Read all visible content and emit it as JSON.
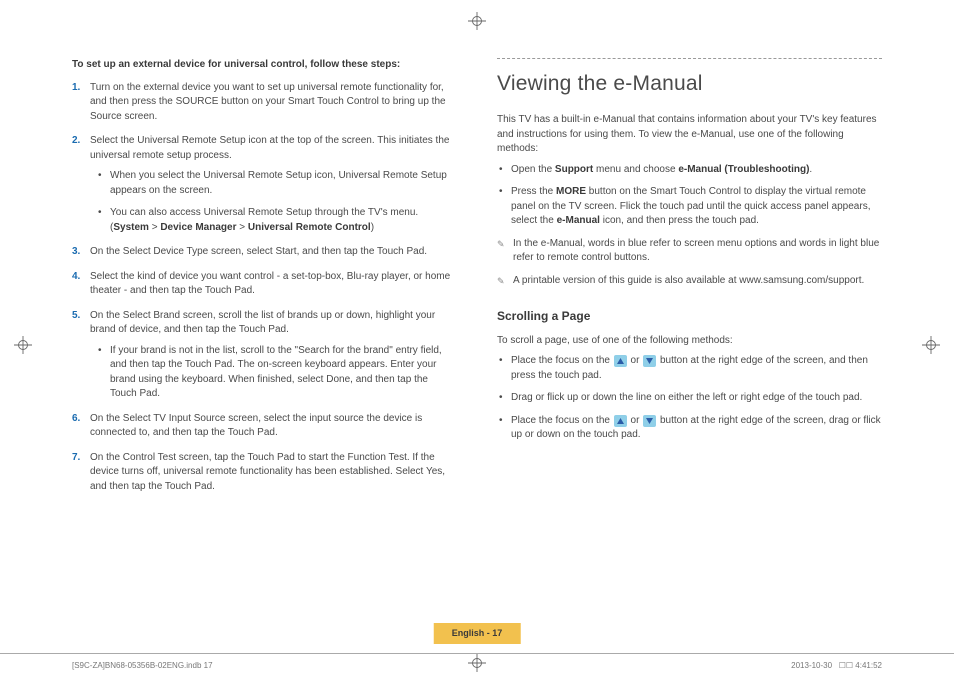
{
  "left": {
    "heading": "To set up an external device for universal control, follow these steps:",
    "steps": [
      {
        "num": "1.",
        "text": "Turn on the external device you want to set up universal remote functionality for, and then press the SOURCE button on your Smart Touch Control to bring up the Source screen."
      },
      {
        "num": "2.",
        "text": "Select the Universal Remote Setup icon at the top of the screen. This initiates the universal remote setup process.",
        "sub": [
          "When you select the Universal Remote Setup icon, Universal Remote Setup appears on the screen.",
          "You can also access Universal Remote Setup through the TV's menu. (",
          ")"
        ],
        "menu_path": [
          "System",
          " > ",
          "Device Manager",
          " > ",
          "Universal Remote Control"
        ]
      },
      {
        "num": "3.",
        "text": "On the Select Device Type screen, select Start, and then tap the Touch Pad."
      },
      {
        "num": "4.",
        "text": "Select the kind of device you want control - a set-top-box, Blu-ray player, or home theater - and then tap the Touch Pad."
      },
      {
        "num": "5.",
        "text": "On the Select Brand screen, scroll the list of brands up or down, highlight your brand of device, and then tap the Touch Pad.",
        "sub5": "If your brand is not in the list, scroll to the \"Search for the brand\" entry field, and then tap the Touch Pad. The on-screen keyboard appears. Enter your brand using the keyboard. When finished, select Done, and then tap the Touch Pad."
      },
      {
        "num": "6.",
        "text": "On the Select TV Input Source screen, select the input source the device is connected to, and then tap the Touch Pad."
      },
      {
        "num": "7.",
        "text": "On the Control Test screen, tap the Touch Pad to start the Function Test. If the device turns off, universal remote functionality has been established. Select Yes, and then tap the Touch Pad."
      }
    ]
  },
  "right": {
    "title": "Viewing the e-Manual",
    "intro": "This TV has a built-in e-Manual that contains information about your TV's key features and instructions for using them. To view the e-Manual, use one of the following methods:",
    "bullets": [
      {
        "pre": "Open the ",
        "b1": "Support",
        "mid": " menu and choose ",
        "b2": "e-Manual (Troubleshooting)",
        "post": "."
      },
      {
        "pre": "Press the ",
        "b1": "MORE",
        "mid": " button on the Smart Touch Control to display the virtual remote panel on the TV screen. Flick the touch pad until the quick access panel appears, select the ",
        "b2": "e-Manual",
        "post": " icon, and then press the touch pad."
      }
    ],
    "notes": [
      "In the e-Manual, words in blue refer to screen menu options and words in light blue refer to remote control buttons.",
      "A printable version of this guide is also available at www.samsung.com/support."
    ],
    "scroll_head": "Scrolling a Page",
    "scroll_intro": "To scroll a page, use of one of the following methods:",
    "scroll_items": [
      {
        "pre": "Place the focus on the ",
        "mid": " or ",
        "post": " button at the right edge of the screen, and then press the touch pad."
      },
      {
        "text": "Drag or flick up or down the line on either the left or right edge of the touch pad."
      },
      {
        "pre": "Place the focus on the ",
        "mid": " or ",
        "post": " button at the right edge of the screen, drag or flick up or down on the touch pad."
      }
    ]
  },
  "page_label": "English - 17",
  "footer": {
    "left": "[S9C-ZA]BN68-05356B-02ENG.indb   17",
    "right_date": "2013-10-30",
    "right_time": "☐☐ 4:41:52"
  }
}
